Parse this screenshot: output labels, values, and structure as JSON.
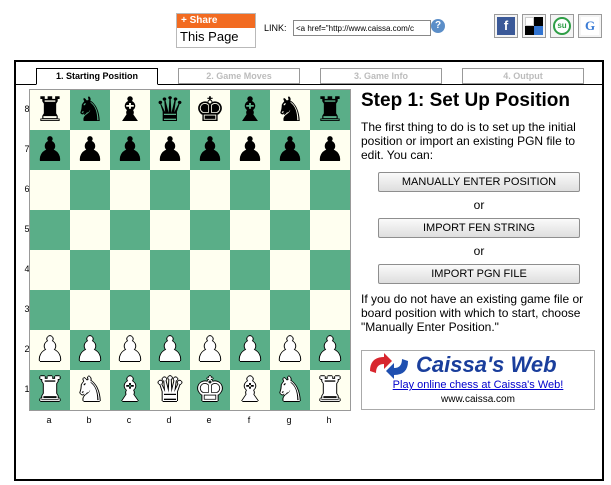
{
  "share": {
    "button_label": "+ Share",
    "sub_label": "This Page"
  },
  "link": {
    "label": "LINK:",
    "value": "<a href=\"http://www.caissa.com/c"
  },
  "social": [
    {
      "name": "facebook",
      "glyph": "f"
    },
    {
      "name": "delicious",
      "glyph": ""
    },
    {
      "name": "stumbleupon",
      "glyph": "su"
    },
    {
      "name": "google",
      "glyph": "G"
    }
  ],
  "tabs": [
    {
      "label": "1. Starting Position",
      "active": true
    },
    {
      "label": "2. Game Moves",
      "active": false
    },
    {
      "label": "3. Game Info",
      "active": false
    },
    {
      "label": "4. Output",
      "active": false
    }
  ],
  "board": {
    "ranks": [
      "8",
      "7",
      "6",
      "5",
      "4",
      "3",
      "2",
      "1"
    ],
    "files": [
      "a",
      "b",
      "c",
      "d",
      "e",
      "f",
      "g",
      "h"
    ],
    "position": [
      [
        "r",
        "n",
        "b",
        "q",
        "k",
        "b",
        "n",
        "r"
      ],
      [
        "p",
        "p",
        "p",
        "p",
        "p",
        "p",
        "p",
        "p"
      ],
      [
        "",
        "",
        "",
        "",
        "",
        "",
        "",
        ""
      ],
      [
        "",
        "",
        "",
        "",
        "",
        "",
        "",
        ""
      ],
      [
        "",
        "",
        "",
        "",
        "",
        "",
        "",
        ""
      ],
      [
        "",
        "",
        "",
        "",
        "",
        "",
        "",
        ""
      ],
      [
        "P",
        "P",
        "P",
        "P",
        "P",
        "P",
        "P",
        "P"
      ],
      [
        "R",
        "N",
        "B",
        "Q",
        "K",
        "B",
        "N",
        "R"
      ]
    ],
    "light_color": "#fffff0",
    "dark_color": "#5aae88"
  },
  "panel": {
    "title": "Step 1: Set Up Position",
    "intro": "The first thing to do is to set up the initial position or import an existing PGN file to edit. You can:",
    "btn_manual": "MANUALLY ENTER POSITION",
    "or1": "or",
    "btn_fen": "IMPORT FEN STRING",
    "or2": "or",
    "btn_pgn": "IMPORT PGN FILE",
    "outro": "If you do not have an existing game file or board position with which to start, choose \"Manually Enter Position.\""
  },
  "ad": {
    "title": "Caissa's Web",
    "link": "Play online chess at Caissa's Web!",
    "url": "www.caissa.com"
  }
}
